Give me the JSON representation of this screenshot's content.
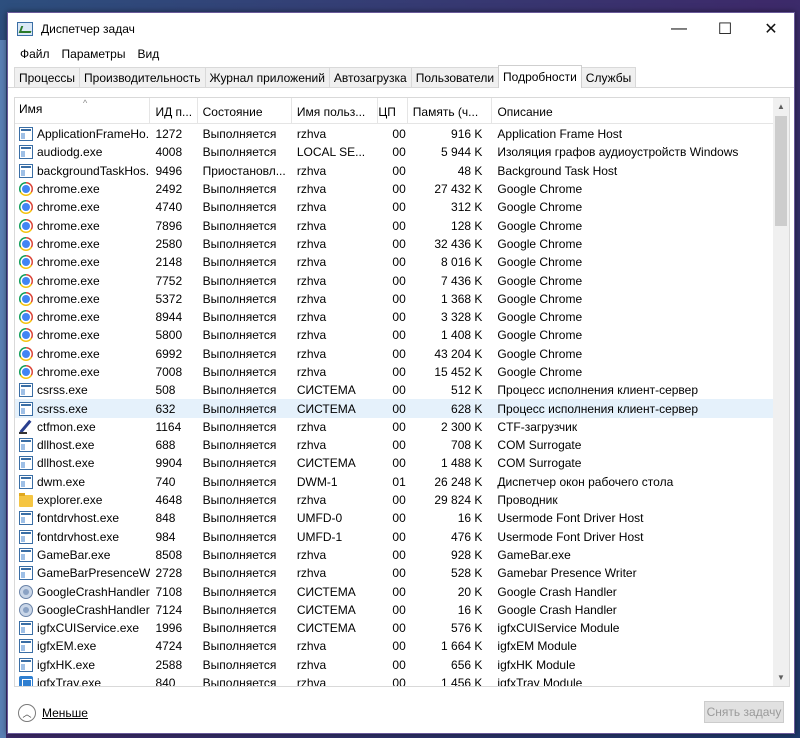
{
  "window": {
    "title": "Диспетчер задач"
  },
  "controls": {
    "minimize": "—",
    "maximize": "☐",
    "close": "✕"
  },
  "menu": [
    "Файл",
    "Параметры",
    "Вид"
  ],
  "tabs": [
    "Процессы",
    "Производительность",
    "Журнал приложений",
    "Автозагрузка",
    "Пользователи",
    "Подробности",
    "Службы"
  ],
  "active_tab": "Подробности",
  "columns": [
    "Имя",
    "ИД п...",
    "Состояние",
    "Имя польз...",
    "ЦП",
    "Память (ч...",
    "Описание"
  ],
  "sort_indicator": "^",
  "processes": [
    {
      "icon": "app",
      "name": "ApplicationFrameHo...",
      "pid": "1272",
      "state": "Выполняется",
      "user": "rzhva",
      "cpu": "00",
      "mem": "916 K",
      "desc": "Application Frame Host"
    },
    {
      "icon": "app",
      "name": "audiodg.exe",
      "pid": "4008",
      "state": "Выполняется",
      "user": "LOCAL SE...",
      "cpu": "00",
      "mem": "5 944 K",
      "desc": "Изоляция графов аудиоустройств Windows"
    },
    {
      "icon": "app",
      "name": "backgroundTaskHos...",
      "pid": "9496",
      "state": "Приостановл...",
      "user": "rzhva",
      "cpu": "00",
      "mem": "48 K",
      "desc": "Background Task Host"
    },
    {
      "icon": "chrome",
      "name": "chrome.exe",
      "pid": "2492",
      "state": "Выполняется",
      "user": "rzhva",
      "cpu": "00",
      "mem": "27 432 K",
      "desc": "Google Chrome"
    },
    {
      "icon": "chrome",
      "name": "chrome.exe",
      "pid": "4740",
      "state": "Выполняется",
      "user": "rzhva",
      "cpu": "00",
      "mem": "312 K",
      "desc": "Google Chrome"
    },
    {
      "icon": "chrome",
      "name": "chrome.exe",
      "pid": "7896",
      "state": "Выполняется",
      "user": "rzhva",
      "cpu": "00",
      "mem": "128 K",
      "desc": "Google Chrome"
    },
    {
      "icon": "chrome",
      "name": "chrome.exe",
      "pid": "2580",
      "state": "Выполняется",
      "user": "rzhva",
      "cpu": "00",
      "mem": "32 436 K",
      "desc": "Google Chrome"
    },
    {
      "icon": "chrome",
      "name": "chrome.exe",
      "pid": "2148",
      "state": "Выполняется",
      "user": "rzhva",
      "cpu": "00",
      "mem": "8 016 K",
      "desc": "Google Chrome"
    },
    {
      "icon": "chrome",
      "name": "chrome.exe",
      "pid": "7752",
      "state": "Выполняется",
      "user": "rzhva",
      "cpu": "00",
      "mem": "7 436 K",
      "desc": "Google Chrome"
    },
    {
      "icon": "chrome",
      "name": "chrome.exe",
      "pid": "5372",
      "state": "Выполняется",
      "user": "rzhva",
      "cpu": "00",
      "mem": "1 368 K",
      "desc": "Google Chrome"
    },
    {
      "icon": "chrome",
      "name": "chrome.exe",
      "pid": "8944",
      "state": "Выполняется",
      "user": "rzhva",
      "cpu": "00",
      "mem": "3 328 K",
      "desc": "Google Chrome"
    },
    {
      "icon": "chrome",
      "name": "chrome.exe",
      "pid": "5800",
      "state": "Выполняется",
      "user": "rzhva",
      "cpu": "00",
      "mem": "1 408 K",
      "desc": "Google Chrome"
    },
    {
      "icon": "chrome",
      "name": "chrome.exe",
      "pid": "6992",
      "state": "Выполняется",
      "user": "rzhva",
      "cpu": "00",
      "mem": "43 204 K",
      "desc": "Google Chrome"
    },
    {
      "icon": "chrome",
      "name": "chrome.exe",
      "pid": "7008",
      "state": "Выполняется",
      "user": "rzhva",
      "cpu": "00",
      "mem": "15 452 K",
      "desc": "Google Chrome"
    },
    {
      "icon": "app",
      "name": "csrss.exe",
      "pid": "508",
      "state": "Выполняется",
      "user": "СИСТЕМА",
      "cpu": "00",
      "mem": "512 K",
      "desc": "Процесс исполнения клиент-сервер"
    },
    {
      "icon": "app",
      "name": "csrss.exe",
      "pid": "632",
      "state": "Выполняется",
      "user": "СИСТЕМА",
      "cpu": "00",
      "mem": "628 K",
      "desc": "Процесс исполнения клиент-сервер",
      "selected": true
    },
    {
      "icon": "pen",
      "name": "ctfmon.exe",
      "pid": "1164",
      "state": "Выполняется",
      "user": "rzhva",
      "cpu": "00",
      "mem": "2 300 K",
      "desc": "CTF-загрузчик"
    },
    {
      "icon": "app",
      "name": "dllhost.exe",
      "pid": "688",
      "state": "Выполняется",
      "user": "rzhva",
      "cpu": "00",
      "mem": "708 K",
      "desc": "COM Surrogate"
    },
    {
      "icon": "app",
      "name": "dllhost.exe",
      "pid": "9904",
      "state": "Выполняется",
      "user": "СИСТЕМА",
      "cpu": "00",
      "mem": "1 488 K",
      "desc": "COM Surrogate"
    },
    {
      "icon": "app",
      "name": "dwm.exe",
      "pid": "740",
      "state": "Выполняется",
      "user": "DWM-1",
      "cpu": "01",
      "mem": "26 248 K",
      "desc": "Диспетчер окон рабочего стола"
    },
    {
      "icon": "folder",
      "name": "explorer.exe",
      "pid": "4648",
      "state": "Выполняется",
      "user": "rzhva",
      "cpu": "00",
      "mem": "29 824 K",
      "desc": "Проводник"
    },
    {
      "icon": "app",
      "name": "fontdrvhost.exe",
      "pid": "848",
      "state": "Выполняется",
      "user": "UMFD-0",
      "cpu": "00",
      "mem": "16 K",
      "desc": "Usermode Font Driver Host"
    },
    {
      "icon": "app",
      "name": "fontdrvhost.exe",
      "pid": "984",
      "state": "Выполняется",
      "user": "UMFD-1",
      "cpu": "00",
      "mem": "476 K",
      "desc": "Usermode Font Driver Host"
    },
    {
      "icon": "app",
      "name": "GameBar.exe",
      "pid": "8508",
      "state": "Выполняется",
      "user": "rzhva",
      "cpu": "00",
      "mem": "928 K",
      "desc": "GameBar.exe"
    },
    {
      "icon": "app",
      "name": "GameBarPresenceWr...",
      "pid": "2728",
      "state": "Выполняется",
      "user": "rzhva",
      "cpu": "00",
      "mem": "528 K",
      "desc": "Gamebar Presence Writer"
    },
    {
      "icon": "crash",
      "name": "GoogleCrashHandler...",
      "pid": "7108",
      "state": "Выполняется",
      "user": "СИСТЕМА",
      "cpu": "00",
      "mem": "20 K",
      "desc": "Google Crash Handler"
    },
    {
      "icon": "crash",
      "name": "GoogleCrashHandler...",
      "pid": "7124",
      "state": "Выполняется",
      "user": "СИСТЕМА",
      "cpu": "00",
      "mem": "16 K",
      "desc": "Google Crash Handler"
    },
    {
      "icon": "app",
      "name": "igfxCUIService.exe",
      "pid": "1996",
      "state": "Выполняется",
      "user": "СИСТЕМА",
      "cpu": "00",
      "mem": "576 K",
      "desc": "igfxCUIService Module"
    },
    {
      "icon": "app",
      "name": "igfxEM.exe",
      "pid": "4724",
      "state": "Выполняется",
      "user": "rzhva",
      "cpu": "00",
      "mem": "1 664 K",
      "desc": "igfxEM Module"
    },
    {
      "icon": "app",
      "name": "igfxHK.exe",
      "pid": "2588",
      "state": "Выполняется",
      "user": "rzhva",
      "cpu": "00",
      "mem": "656 K",
      "desc": "igfxHK Module"
    },
    {
      "icon": "igfx",
      "name": "igfxTray.exe",
      "pid": "840",
      "state": "Выполняется",
      "user": "rzhva",
      "cpu": "00",
      "mem": "1 456 K",
      "desc": "igfxTray Module"
    }
  ],
  "footer": {
    "less_label": "Меньше",
    "end_task_label": "Снять задачу"
  },
  "colors": {
    "selected_row": "#e5f1fb",
    "window_border": "#6a5a9a"
  }
}
